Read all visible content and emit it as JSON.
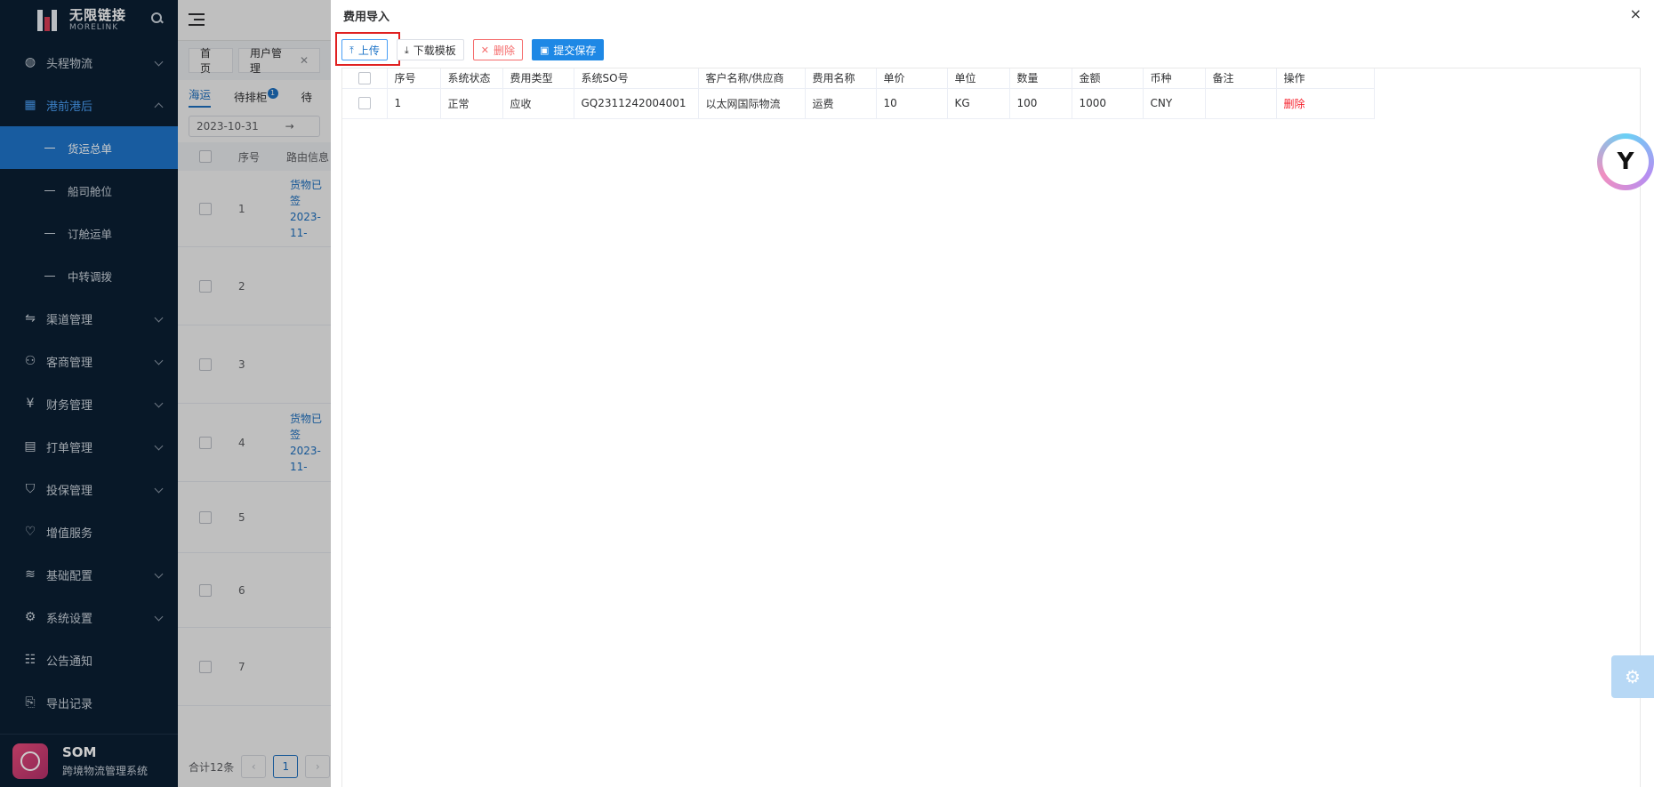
{
  "sidebar": {
    "brand_cn": "无限链接",
    "brand_en": "MORELINK",
    "menu": [
      {
        "label": "头程物流",
        "icon": "globe-icon"
      },
      {
        "label": "港前港后",
        "icon": "grid-icon",
        "open": true,
        "children": [
          "货运总单",
          "船司舱位",
          "订舱运单",
          "中转调拨"
        ],
        "active_child": 0
      },
      {
        "label": "渠道管理",
        "icon": "route-icon"
      },
      {
        "label": "客商管理",
        "icon": "users-icon"
      },
      {
        "label": "财务管理",
        "icon": "yen-icon"
      },
      {
        "label": "打单管理",
        "icon": "printer-icon"
      },
      {
        "label": "投保管理",
        "icon": "shield-icon"
      },
      {
        "label": "增值服务",
        "icon": "heart-icon"
      },
      {
        "label": "基础配置",
        "icon": "layers-icon"
      },
      {
        "label": "系统设置",
        "icon": "gear-icon"
      },
      {
        "label": "公告通知",
        "icon": "notice-icon"
      },
      {
        "label": "导出记录",
        "icon": "export-icon"
      }
    ],
    "footer": {
      "title": "SOM",
      "subtitle": "跨境物流管理系统"
    }
  },
  "background": {
    "tags": [
      {
        "label": "首页"
      },
      {
        "label": "用户管理",
        "closable": true
      }
    ],
    "subtabs": [
      "海运",
      "待排柜",
      "待"
    ],
    "subtab_badge": "1",
    "date": "2023-10-31",
    "date_sep": "→",
    "table_headers": [
      "序号",
      "路由信息"
    ],
    "rows": [
      {
        "num": "1",
        "link": "货物已签",
        "date": "2023-11-"
      },
      {
        "num": "2"
      },
      {
        "num": "3"
      },
      {
        "num": "4",
        "link": "货物已签",
        "date": "2023-11-"
      },
      {
        "num": "5"
      },
      {
        "num": "6"
      },
      {
        "num": "7"
      }
    ],
    "pager": {
      "total": "合计12条",
      "current": "1"
    }
  },
  "drawer": {
    "title": "费用导入",
    "close": "×",
    "toolbar": {
      "upload": "上传",
      "download": "下载模板",
      "delete": "删除",
      "submit": "提交保存"
    },
    "columns": [
      "序号",
      "系统状态",
      "费用类型",
      "系统SO号",
      "客户名称/供应商",
      "费用名称",
      "单价",
      "单位",
      "数量",
      "金额",
      "币种",
      "备注",
      "操作"
    ],
    "rows": [
      {
        "seq": "1",
        "status": "正常",
        "fee_type": "应收",
        "so": "GQ2311242004001",
        "customer": "以太网国际物流",
        "fee_name": "运费",
        "price": "10",
        "unit": "KG",
        "qty": "100",
        "amount": "1000",
        "currency": "CNY",
        "remark": "",
        "action": "删除"
      }
    ]
  },
  "colors": {
    "primary": "#1e88e5",
    "danger": "#f56c6c",
    "sidebar_bg": "#0b1f33",
    "active_menu": "#1e74c8"
  }
}
